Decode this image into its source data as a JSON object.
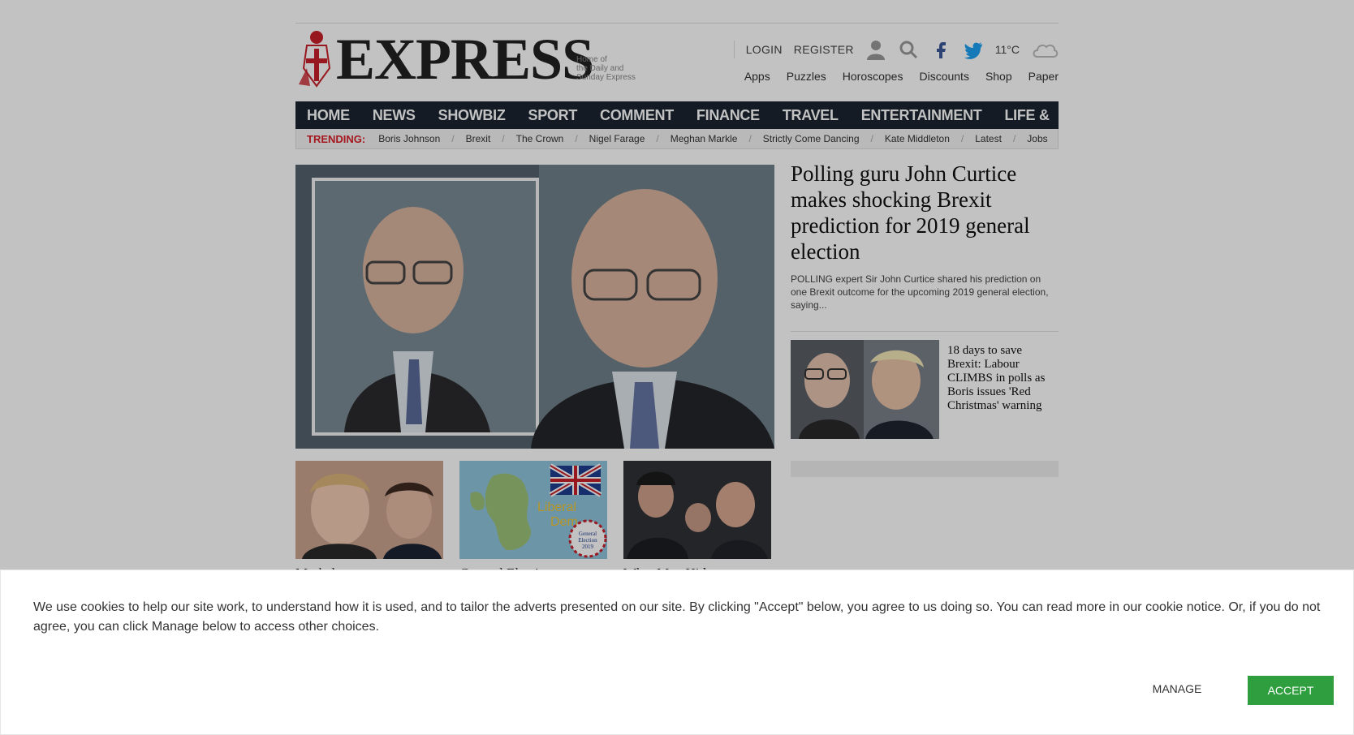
{
  "header": {
    "logo_word": "EXPRESS",
    "logo_tagline": [
      "Home of",
      "the Daily and",
      "Sunday Express"
    ],
    "login": "LOGIN",
    "register": "REGISTER",
    "temperature": "11°C",
    "icons": [
      "user-icon",
      "search-icon",
      "facebook-icon",
      "twitter-icon",
      "cloud-icon"
    ],
    "services": [
      "Apps",
      "Puzzles",
      "Horoscopes",
      "Discounts",
      "Shop",
      "Paper"
    ]
  },
  "nav": {
    "items": [
      "HOME",
      "NEWS",
      "SHOWBIZ & TV",
      "SPORT",
      "COMMENT",
      "FINANCE",
      "TRAVEL",
      "ENTERTAINMENT",
      "LIFE & STYLE"
    ]
  },
  "trending": {
    "label": "TRENDING:",
    "items": [
      "Boris Johnson",
      "Brexit",
      "The Crown",
      "Nigel Farage",
      "Meghan Markle",
      "Strictly Come Dancing",
      "Kate Middleton",
      "Latest",
      "Jobs"
    ]
  },
  "lead": {
    "title": "Polling guru John Curtice makes shocking Brexit prediction for 2019 general election",
    "summary": "POLLING expert Sir John Curtice shared his prediction on one Brexit outcome for the upcoming 2019 general election, saying..."
  },
  "side_story": {
    "title": "18 days to save Brexit: Labour CLIMBS in polls as Boris issues 'Red Christmas' warning"
  },
  "cards": [
    {
      "title": "Merkel swoops to..."
    },
    {
      "title": "General Election...",
      "overlay_text": [
        "Liberal",
        "Dem",
        "General",
        "Election",
        "2019"
      ]
    },
    {
      "title": "What May Hid to..."
    }
  ],
  "cookie": {
    "text": "We use cookies to help our site work, to understand how it is used, and to tailor the adverts presented on our site. By clicking \"Accept\" below, you agree to us doing so. You can read more in our cookie notice. Or, if you do not agree, you can click Manage below to access other choices.",
    "manage_label": "MANAGE",
    "accept_label": "ACCEPT"
  },
  "colors": {
    "nav_bg": "#1b2430",
    "trending_accent": "#d9202a",
    "accept_bg": "#2e9e3e",
    "twitter": "#1da1f2",
    "facebook": "#3b5998"
  }
}
